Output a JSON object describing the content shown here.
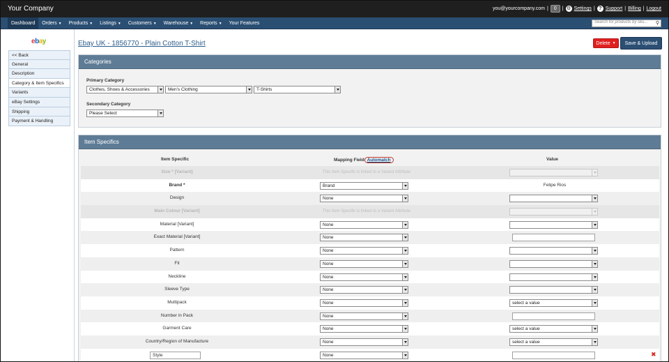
{
  "topbar": {
    "brand": "Your Company",
    "email": "you@yourcompany.com",
    "notif_count": "0",
    "settings": "Settings",
    "support": "Support",
    "billing": "Billing",
    "logout": "Logout"
  },
  "nav": {
    "items": [
      "Dashboard",
      "Orders",
      "Products",
      "Listings",
      "Customers",
      "Warehouse",
      "Reports",
      "Your Features"
    ],
    "search_placeholder": "Search for products by sku..."
  },
  "sidebar": {
    "logo": {
      "e": "e",
      "b": "b",
      "a": "a",
      "y": "y"
    },
    "items": [
      "<< Back",
      "General",
      "Description",
      "Category & Item Specifics",
      "Variants",
      "eBay Settings",
      "Shipping",
      "Payment & Handling"
    ]
  },
  "page": {
    "title": "Ebay UK - 1856770 - Plain Cotton T-Shirt",
    "delete_label": "Delete",
    "save_label": "Save & Upload"
  },
  "categories": {
    "heading": "Categories",
    "primary_label": "Primary Category",
    "primary_values": [
      "Clothes, Shoes & Accessories",
      "Men's Clothing",
      "T-Shirts"
    ],
    "secondary_label": "Secondary Category",
    "secondary_value": "Please Select"
  },
  "specifics": {
    "heading": "Item Specifics",
    "col_item": "Item Specific",
    "col_mapping": "Mapping Field",
    "automatch": "Automatch",
    "col_value": "Value",
    "variant_note": "This Item Specific is linked to a Variant Attribute",
    "rows": [
      {
        "name": "Size * [Variant]",
        "mapping": "",
        "value": ""
      },
      {
        "name": "Brand *",
        "mapping": "Brand",
        "value": "Felipe Rios"
      },
      {
        "name": "Design",
        "mapping": "None",
        "value": ""
      },
      {
        "name": "Main Colour [Variant]",
        "mapping": "",
        "value": ""
      },
      {
        "name": "Material [Variant]",
        "mapping": "None",
        "value": ""
      },
      {
        "name": "Exact Material [Variant]",
        "mapping": "None",
        "value": ""
      },
      {
        "name": "Pattern",
        "mapping": "None",
        "value": ""
      },
      {
        "name": "Fit",
        "mapping": "None",
        "value": ""
      },
      {
        "name": "Neckline",
        "mapping": "None",
        "value": ""
      },
      {
        "name": "Sleeve Type",
        "mapping": "None",
        "value": ""
      },
      {
        "name": "Multipack",
        "mapping": "None",
        "value": "select a value"
      },
      {
        "name": "Number in Pack",
        "mapping": "None",
        "value": ""
      },
      {
        "name": "Garment Care",
        "mapping": "None",
        "value": "select a value"
      },
      {
        "name": "Country/Region of Manufacture",
        "mapping": "None",
        "value": "select a value"
      },
      {
        "name": "Style",
        "mapping": "None",
        "value": ""
      }
    ]
  }
}
